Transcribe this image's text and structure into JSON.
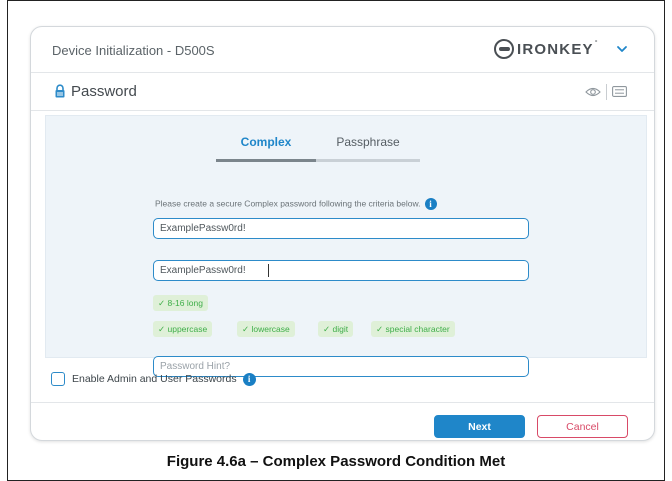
{
  "window": {
    "title": "Device Initialization - D500S",
    "brand": "IRONKEY",
    "brand_mark": "°"
  },
  "section": {
    "title": "Password"
  },
  "tabs": [
    {
      "label": "Complex",
      "active": true
    },
    {
      "label": "Passphrase",
      "active": false
    }
  ],
  "instructions": "Please create a secure Complex password following the criteria below.",
  "password": {
    "value": "ExamplePassw0rd!",
    "confirm_value": "ExamplePassw0rd!",
    "hint_placeholder": "Password Hint?"
  },
  "criteria": [
    "✓ 8-16 long",
    "✓ uppercase",
    "✓ lowercase",
    "✓ digit",
    "✓ special character"
  ],
  "admin_option": {
    "label": "Enable Admin and User Passwords",
    "checked": false
  },
  "buttons": {
    "next": "Next",
    "cancel": "Cancel"
  },
  "caption": "Figure 4.6a – Complex Password Condition Met",
  "colors": {
    "accent": "#1f86c9",
    "criteria_ok": "#3fae49",
    "criteria_bg": "#dff0d8",
    "cancel": "#d84a67",
    "panel_bg": "#eef4f9"
  },
  "icons": [
    "ironkey-logo-icon",
    "chevron-down-icon",
    "lock-icon",
    "eye-icon",
    "keyboard-icon",
    "info-icon",
    "checkbox-icon"
  ]
}
